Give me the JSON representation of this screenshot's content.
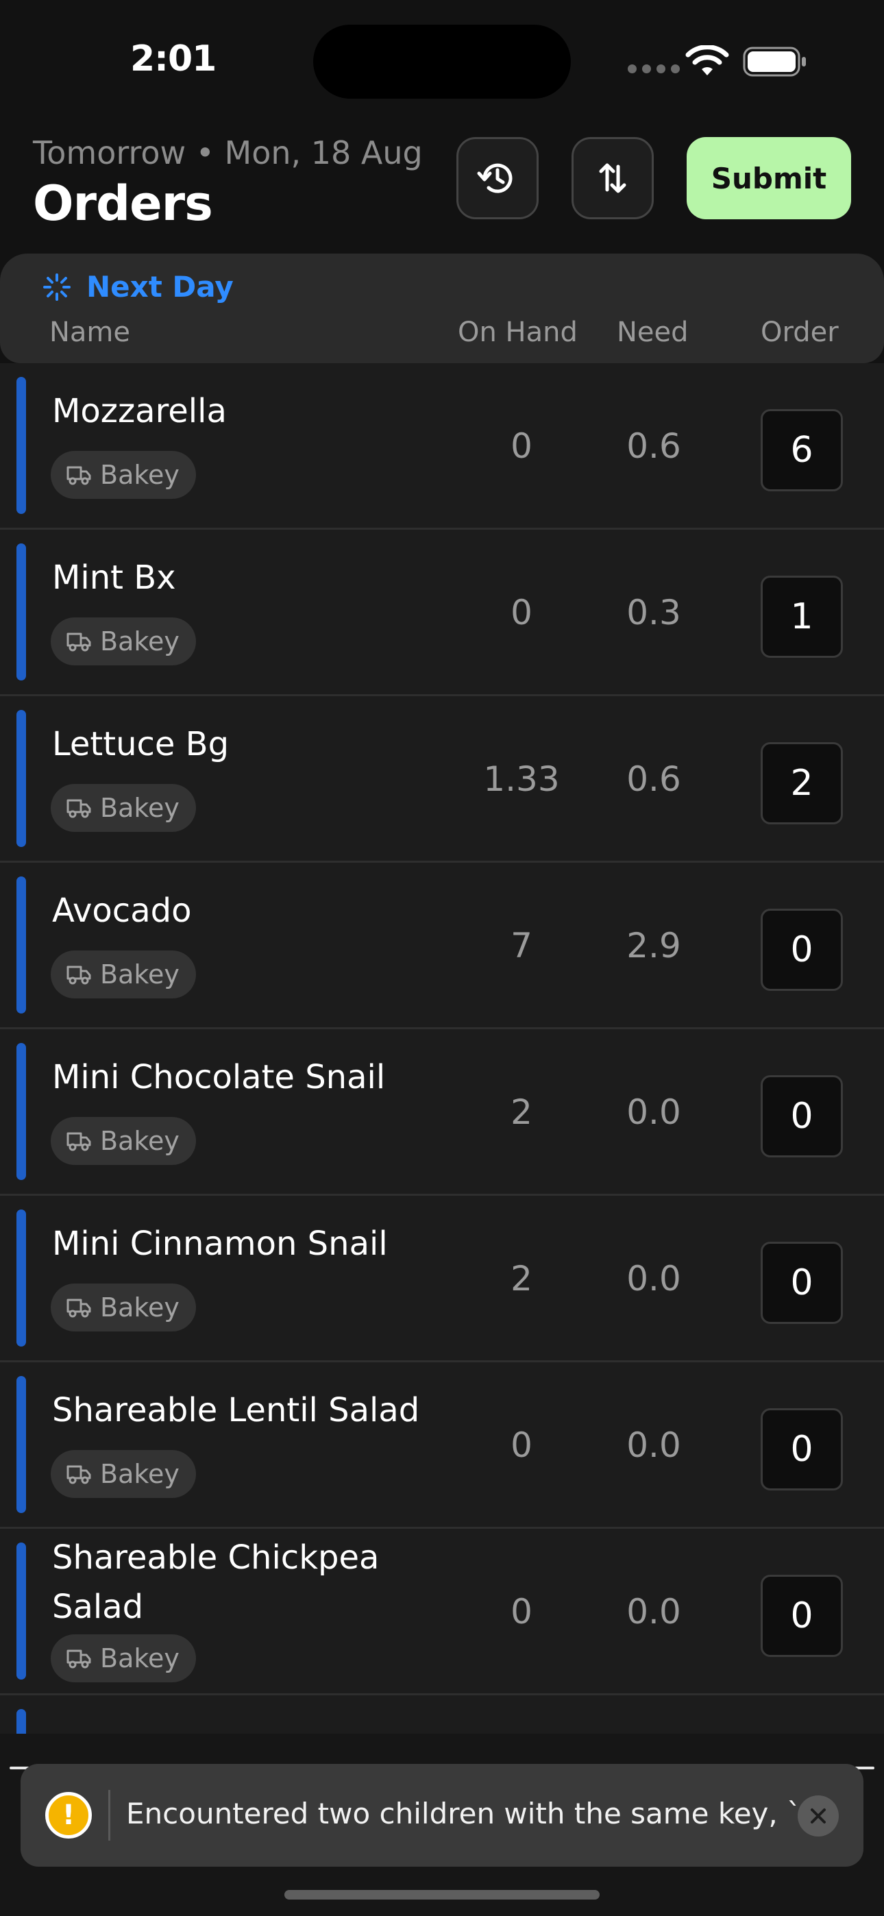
{
  "status": {
    "time": "2:01"
  },
  "header": {
    "subtitle": "Tomorrow • Mon, 18 Aug",
    "title": "Orders",
    "submit_label": "Submit"
  },
  "table": {
    "section_label": "Next Day",
    "columns": {
      "name": "Name",
      "on_hand": "On Hand",
      "need": "Need",
      "order": "Order"
    }
  },
  "rows": [
    {
      "name": "Mozzarella",
      "vendor": "Bakey",
      "on_hand": "0",
      "need": "0.6",
      "order": "6"
    },
    {
      "name": "Mint Bx",
      "vendor": "Bakey",
      "on_hand": "0",
      "need": "0.3",
      "order": "1"
    },
    {
      "name": "Lettuce Bg",
      "vendor": "Bakey",
      "on_hand": "1.33",
      "need": "0.6",
      "order": "2"
    },
    {
      "name": "Avocado",
      "vendor": "Bakey",
      "on_hand": "7",
      "need": "2.9",
      "order": "0"
    },
    {
      "name": "Mini Chocolate Snail",
      "vendor": "Bakey",
      "on_hand": "2",
      "need": "0.0",
      "order": "0"
    },
    {
      "name": "Mini Cinnamon Snail",
      "vendor": "Bakey",
      "on_hand": "2",
      "need": "0.0",
      "order": "0"
    },
    {
      "name": "Shareable Lentil Salad",
      "vendor": "Bakey",
      "on_hand": "0",
      "need": "0.0",
      "order": "0"
    },
    {
      "name": "Shareable Chickpea Salad",
      "vendor": "Bakey",
      "on_hand": "0",
      "need": "0.0",
      "order": "0"
    }
  ],
  "toast": {
    "message": "Encountered two children with the same key, `...."
  },
  "colors": {
    "accent_blue": "#2f8cff",
    "submit_green": "#b7f5a8",
    "row_bar": "#1e5fc8",
    "warning": "#f5b400"
  }
}
